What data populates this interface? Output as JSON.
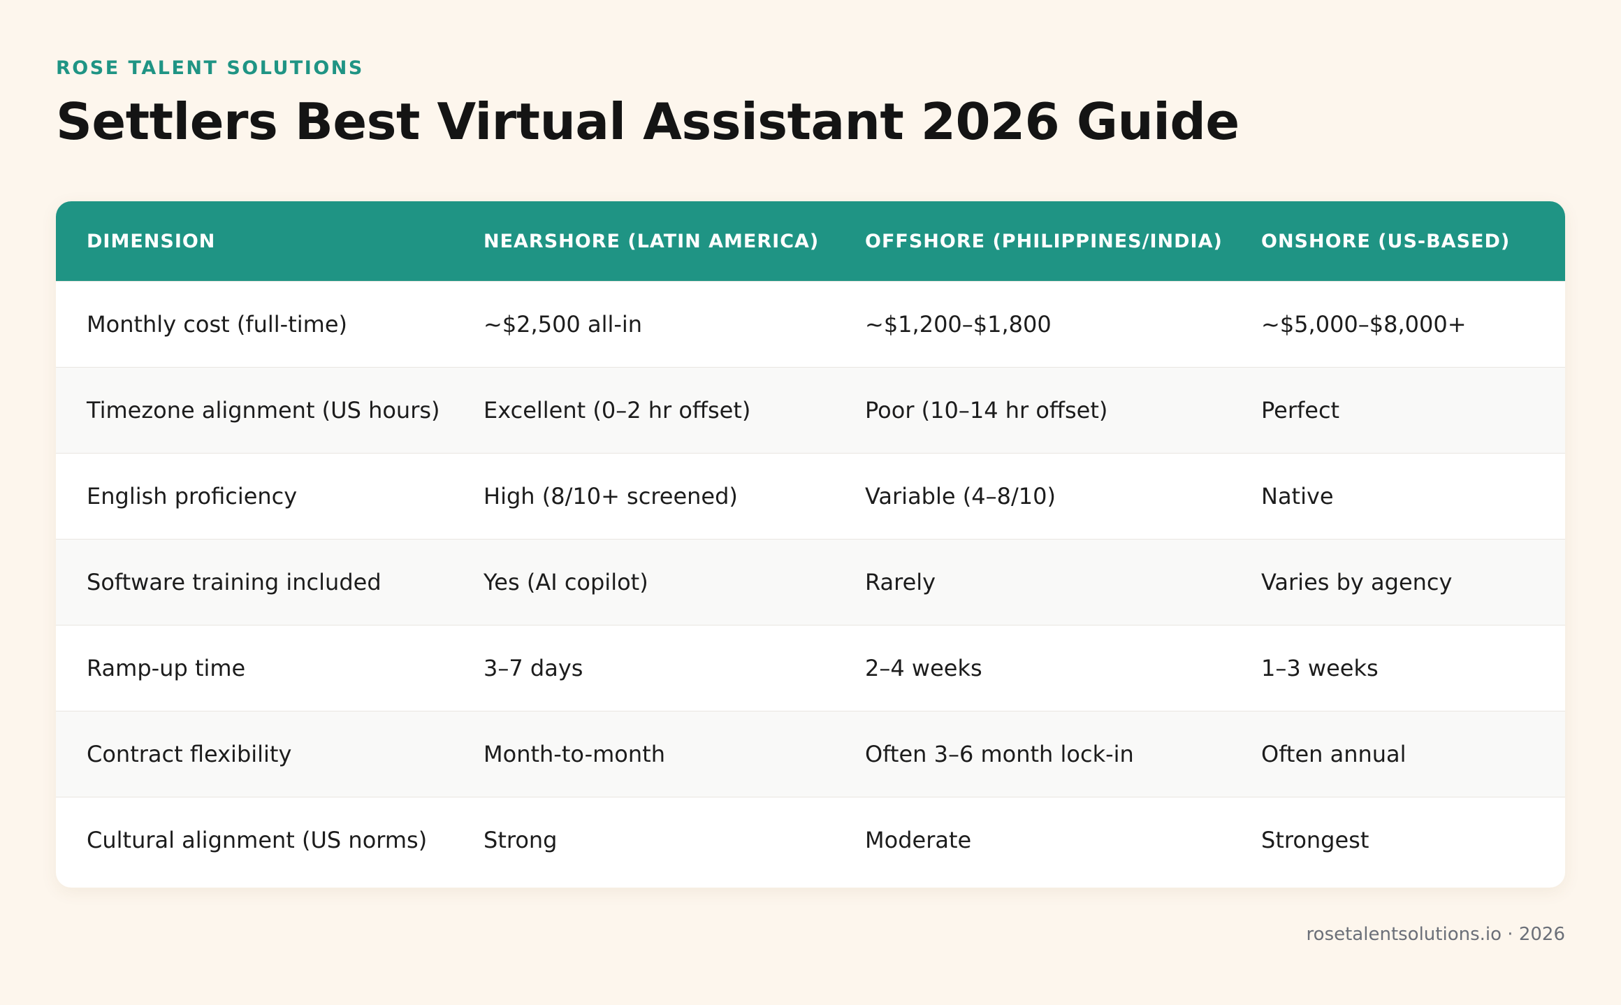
{
  "header": {
    "brand": "ROSE TALENT SOLUTIONS",
    "title": "Settlers Best Virtual Assistant 2026 Guide"
  },
  "table": {
    "columns": [
      "DIMENSION",
      "NEARSHORE (LATIN AMERICA)",
      "OFFSHORE (PHILIPPINES/INDIA)",
      "ONSHORE (US-BASED)"
    ],
    "rows": [
      [
        "Monthly cost (full-time)",
        "~$2,500 all-in",
        "~$1,200–$1,800",
        "~$5,000–$8,000+"
      ],
      [
        "Timezone alignment (US hours)",
        "Excellent (0–2 hr offset)",
        "Poor (10–14 hr offset)",
        "Perfect"
      ],
      [
        "English proficiency",
        "High (8/10+ screened)",
        "Variable (4–8/10)",
        "Native"
      ],
      [
        "Software training included",
        "Yes (AI copilot)",
        "Rarely",
        "Varies by agency"
      ],
      [
        "Ramp-up time",
        "3–7 days",
        "2–4 weeks",
        "1–3 weeks"
      ],
      [
        "Contract flexibility",
        "Month-to-month",
        "Often 3–6 month lock-in",
        "Often annual"
      ],
      [
        "Cultural alignment (US norms)",
        "Strong",
        "Moderate",
        "Strongest"
      ]
    ]
  },
  "footer": {
    "text": "rosetalentsolutions.io · 2026"
  },
  "colors": {
    "accent": "#1f9484",
    "background": "#fdf6ed",
    "row_alt": "#f9f9f8"
  }
}
